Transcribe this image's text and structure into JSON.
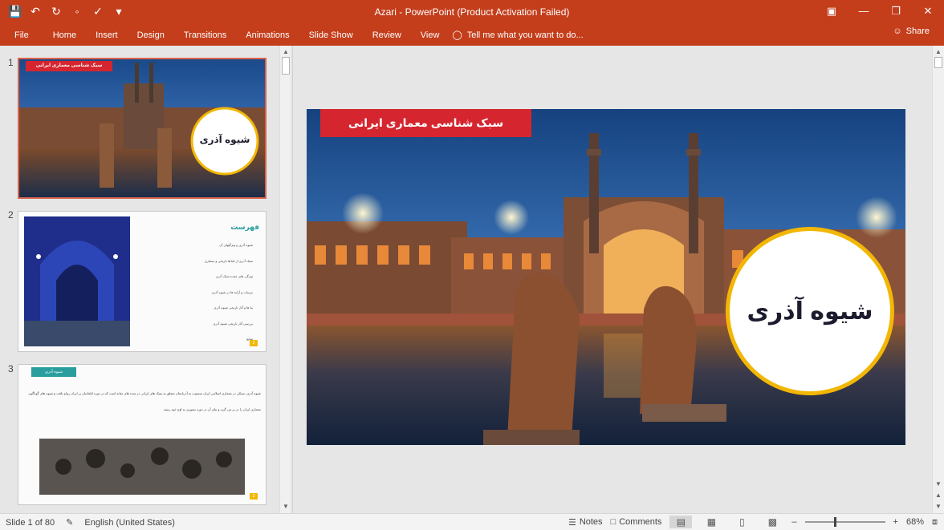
{
  "window": {
    "title": "Azari - PowerPoint (Product Activation Failed)"
  },
  "ribbon": {
    "tabs": [
      "File",
      "Home",
      "Insert",
      "Design",
      "Transitions",
      "Animations",
      "Slide Show",
      "Review",
      "View"
    ],
    "tell_me": "Tell me what you want to do...",
    "share": "Share"
  },
  "thumbnails": [
    {
      "number": "1",
      "banner": "سبک شناسی معماری ایرانی",
      "circle_text": "شیوه آذری"
    },
    {
      "number": "2",
      "heading": "فهرست",
      "items": [
        "شیوه آذری و ویژگیهای آن",
        "سبک آذری از لحاظ تاریخی و معماری",
        "ویژگی های عمده سبک آذری",
        "تزیینات و آرایه ها در شیوه آذری",
        "بنا ها و آثار تاریخی شیوه آذری",
        "بررسی آثار تاریخی شیوه آذری",
        "منابع"
      ],
      "page": "2"
    },
    {
      "number": "3",
      "banner": "شیوه آذری",
      "body": "شیوه آذری، سبکی در معماری اسلامی ایران منسوب به آذربایجان متعلق به سبک های ایرانی در سده های میانه است که در دوره ایلخانیان بر ایران رواج یافت و شیوه های گوناگون معماری ایران را در بر می گیرد و بنای آن در دوره تیموری به اوج خود رسید",
      "page": "3"
    }
  ],
  "slide": {
    "banner": "سبک شناسی معماری ایرانی",
    "circle_text": "شیوه آذری"
  },
  "status": {
    "slide_info": "Slide 1 of 80",
    "language": "English (United States)",
    "notes": "Notes",
    "comments": "Comments",
    "zoom": "68%"
  },
  "colors": {
    "accent": "#c43e1c",
    "banner_red": "#d5262f",
    "circle_gold": "#f2b705",
    "teal": "#2a9d9f"
  }
}
